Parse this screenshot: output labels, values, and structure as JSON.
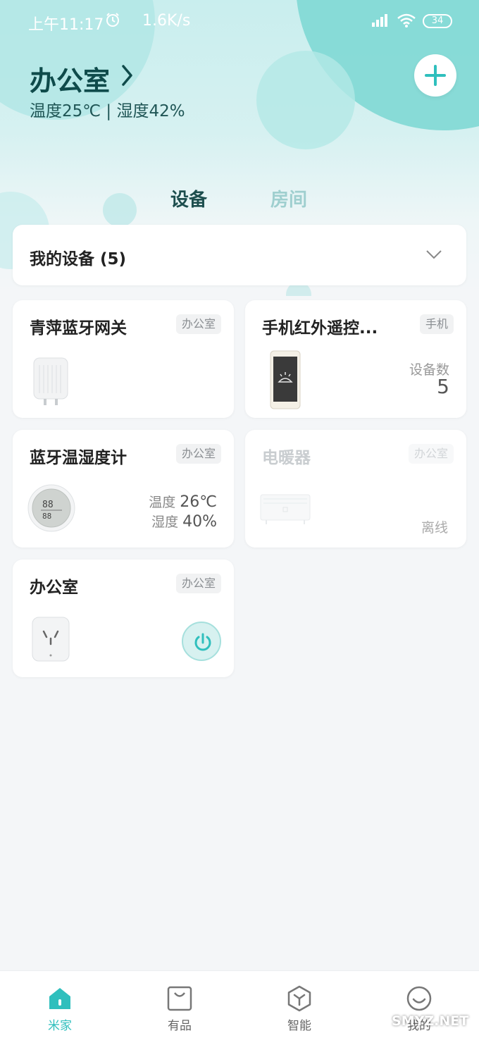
{
  "status_bar": {
    "time": "上午11:17",
    "speed": "1.6K/s",
    "battery": "34"
  },
  "header": {
    "room_title": "办公室",
    "env": "温度25℃ | 湿度42%"
  },
  "tabs": [
    {
      "label": "设备",
      "active": true
    },
    {
      "label": "房间",
      "active": false
    }
  ],
  "my_devices": {
    "label": "我的设备 (5)"
  },
  "devices": [
    {
      "name": "青萍蓝牙网关",
      "room": "办公室"
    },
    {
      "name": "手机红外遥控...",
      "room": "手机",
      "stat_label": "设备数",
      "stat_value": "5"
    },
    {
      "name": "蓝牙温湿度计",
      "room": "办公室",
      "temp_label": "温度",
      "temp_value": "26℃",
      "hum_label": "湿度",
      "hum_value": "40%"
    },
    {
      "name": "电暖器",
      "room": "办公室",
      "status": "离线"
    },
    {
      "name": "办公室",
      "room": "办公室"
    }
  ],
  "bottom_nav": [
    {
      "label": "米家",
      "icon": "home-icon",
      "active": true
    },
    {
      "label": "有品",
      "icon": "shopping-bag-icon",
      "active": false
    },
    {
      "label": "智能",
      "icon": "smart-hexagon-icon",
      "active": false
    },
    {
      "label": "我的",
      "icon": "profile-smile-icon",
      "active": false
    }
  ],
  "watermark": "SMYZ.NET",
  "colors": {
    "accent": "#2fbfbd",
    "title": "#0f4b4b",
    "background": "#f4f6f8"
  }
}
